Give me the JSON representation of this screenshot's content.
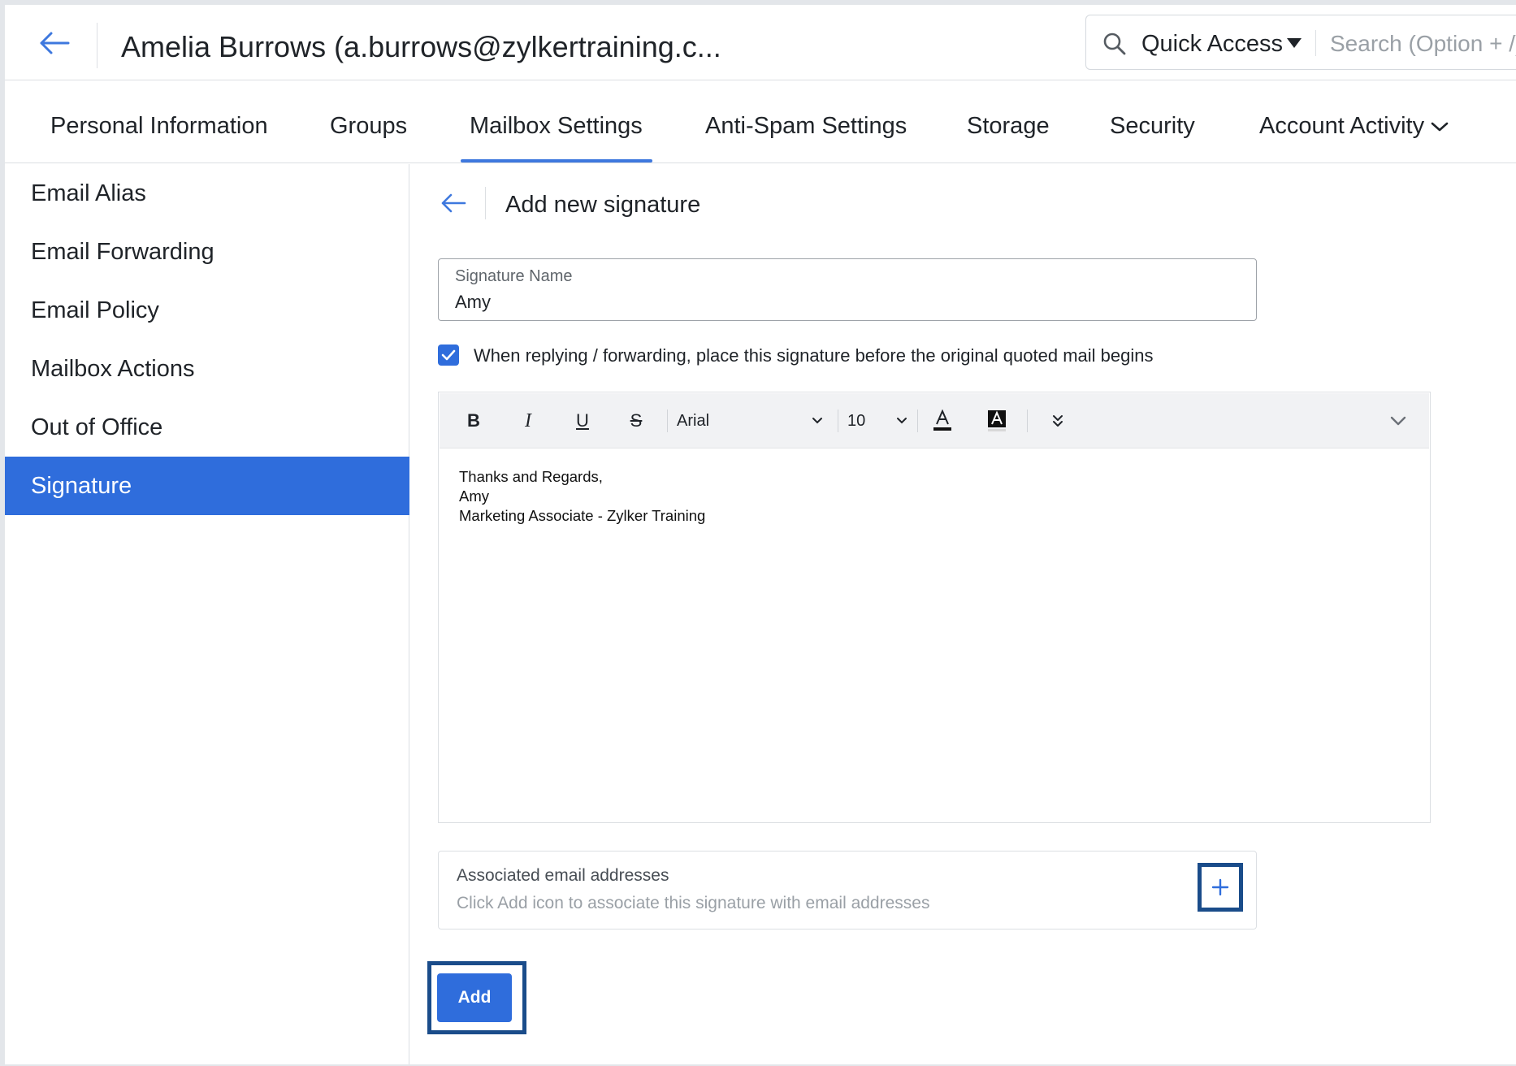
{
  "header": {
    "title": "Amelia Burrows (a.burrows@zylkertraining.c...",
    "back_icon": "arrow-left-icon",
    "quick_access_label": "Quick Access",
    "search_placeholder": "Search (Option + /)"
  },
  "tabs": [
    {
      "label": "Personal Information"
    },
    {
      "label": "Groups"
    },
    {
      "label": "Mailbox Settings",
      "active": true
    },
    {
      "label": "Anti-Spam Settings"
    },
    {
      "label": "Storage"
    },
    {
      "label": "Security"
    },
    {
      "label": "Account Activity"
    }
  ],
  "sidebar": {
    "items": [
      {
        "label": "Email Alias"
      },
      {
        "label": "Email Forwarding"
      },
      {
        "label": "Email Policy"
      },
      {
        "label": "Mailbox Actions"
      },
      {
        "label": "Out of Office"
      },
      {
        "label": "Signature",
        "active": true
      }
    ]
  },
  "signature_form": {
    "title": "Add new signature",
    "name_label": "Signature Name",
    "name_value": "Amy",
    "checkbox_checked": true,
    "checkbox_label": "When replying / forwarding, place this signature before the original quoted mail begins",
    "toolbar": {
      "bold": "B",
      "italic": "I",
      "underline": "U",
      "strike": "S",
      "font_family": "Arial",
      "font_size": "10"
    },
    "body_lines": [
      "Thanks and Regards,",
      "Amy",
      "Marketing Associate - Zylker Training"
    ],
    "associated_label": "Associated email addresses",
    "associated_hint": "Click Add icon to associate this signature with email addresses",
    "add_button": "Add"
  },
  "colors": {
    "accent": "#2f6ddc",
    "tab_underline": "#3e78de",
    "highlight_frame": "#1a4c8a"
  }
}
